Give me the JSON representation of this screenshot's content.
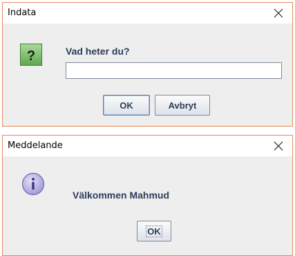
{
  "input_dialog": {
    "title": "Indata",
    "prompt": "Vad heter du?",
    "field": {
      "value": "",
      "placeholder": ""
    },
    "ok_label": "OK",
    "cancel_label": "Avbryt",
    "icon": "question-icon"
  },
  "message_dialog": {
    "title": "Meddelande",
    "message": "Välkommen Mahmud",
    "ok_label": "OK",
    "icon": "info-icon"
  },
  "colors": {
    "border_accent": "#e8885a",
    "dialog_bg": "#eeeeee",
    "label_text": "#2c3d5a",
    "question_icon_bg": "#7cbf6a",
    "info_icon_bg": "#b9b3e6"
  }
}
